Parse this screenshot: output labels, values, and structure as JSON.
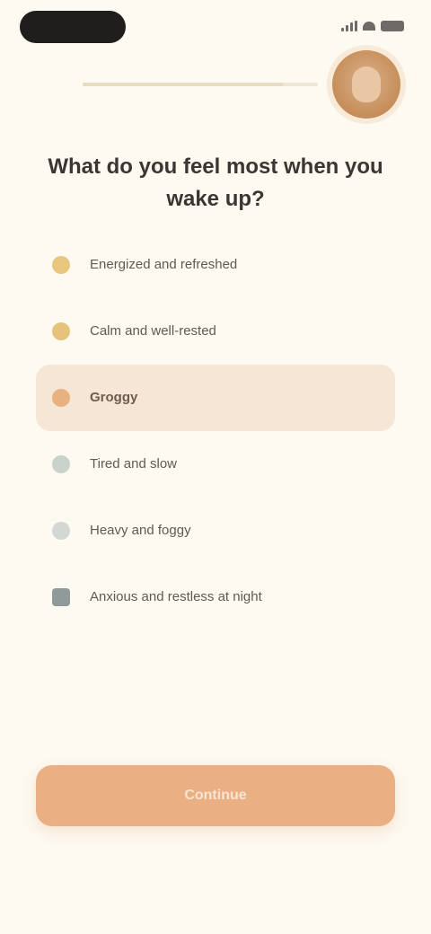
{
  "status_bar": {
    "icons": [
      "signal-icon",
      "wifi-icon",
      "battery-icon"
    ]
  },
  "header": {
    "progress": 0.85
  },
  "question": {
    "text": "What do you feel most when you wake up?"
  },
  "options": [
    {
      "label": "Energized and refreshed",
      "icon": "sun-icon",
      "selected": false
    },
    {
      "label": "Calm and well-rested",
      "icon": "sparkle-icon",
      "selected": false
    },
    {
      "label": "Groggy",
      "icon": "coffee-icon",
      "selected": true
    },
    {
      "label": "Tired and slow",
      "icon": "leaf-icon",
      "selected": false
    },
    {
      "label": "Heavy and foggy",
      "icon": "cloud-icon",
      "selected": false
    },
    {
      "label": "Anxious and restless at night",
      "icon": "moon-icon",
      "selected": false
    }
  ],
  "cta": {
    "label": "Continue"
  },
  "colors": {
    "background": "#FDFAF1",
    "selected_option": "#F6E6D6",
    "accent": "#EBAF84",
    "text": "#3A3631"
  }
}
